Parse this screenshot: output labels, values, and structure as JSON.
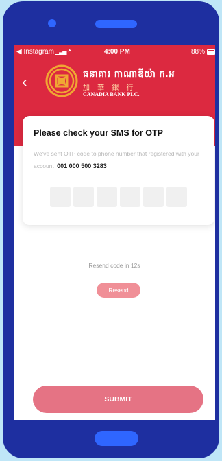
{
  "status_bar": {
    "back_app": "◀ Instagram",
    "time": "4:00 PM",
    "battery": "88%"
  },
  "header": {
    "brand_khmer": "ធនាគារ កាណាឌីយ៉ា ក.អ",
    "brand_chinese": "加 華 銀 行",
    "brand_english": "CANADIA BANK PLC.",
    "colors": {
      "primary": "#dc2940",
      "accent": "#f0a733"
    }
  },
  "otp_card": {
    "title": "Please check your SMS for OTP",
    "description": "We've sent OTP code to phone number that registered with your account",
    "account_number": "001 000 500 3283",
    "digits": [
      "",
      "",
      "",
      "",
      "",
      ""
    ]
  },
  "resend": {
    "countdown_text": "Resend code in 12s",
    "button_label": "Resend"
  },
  "submit": {
    "label": "SUBMIT"
  }
}
